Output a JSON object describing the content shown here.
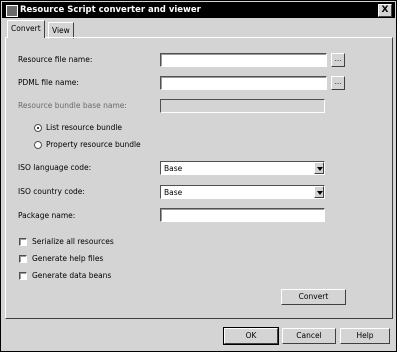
{
  "window": {
    "title": "Resource Script converter and viewer",
    "close_glyph": "X"
  },
  "tabs": [
    {
      "label": "Convert",
      "active": true
    },
    {
      "label": "View",
      "active": false
    }
  ],
  "form": {
    "resource_file_label": "Resource file name:",
    "resource_file_value": "",
    "pdml_file_label": "PDML file name:",
    "pdml_file_value": "",
    "bundle_base_label": "Resource bundle base name:",
    "bundle_base_value": "",
    "radio_list_label": "List resource bundle",
    "radio_property_label": "Property resource bundle",
    "language_label": "ISO language code:",
    "language_value": "Base",
    "country_label": "ISO country code:",
    "country_value": "Base",
    "package_label": "Package name:",
    "package_value": "",
    "serialize_label": "Serialize all resources",
    "help_label": "Generate help files",
    "beans_label": "Generate data beans",
    "convert_label": "Convert",
    "browse_glyph": "..."
  },
  "footer": {
    "ok_label": "OK",
    "cancel_label": "Cancel",
    "help_label": "Help"
  }
}
